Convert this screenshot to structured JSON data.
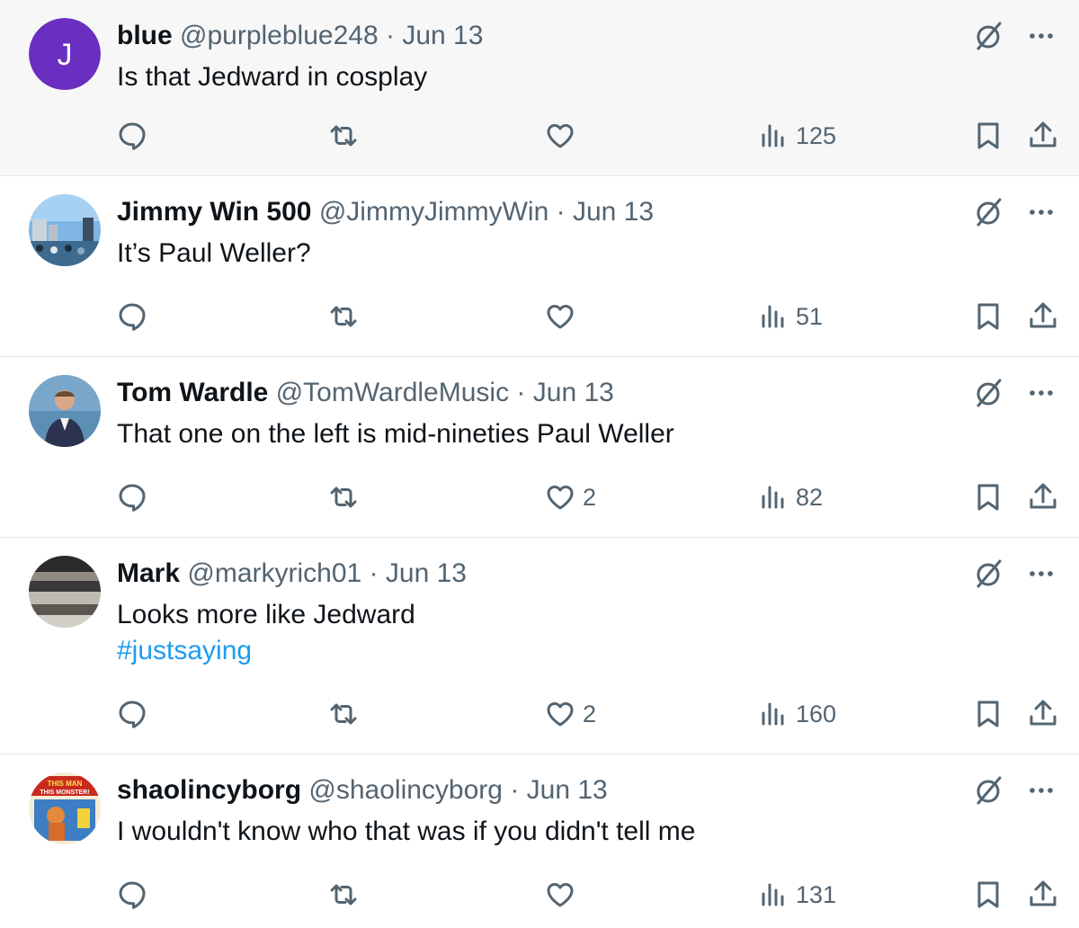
{
  "colors": {
    "text_primary": "#0f1419",
    "text_secondary": "#536471",
    "link": "#1d9bf0",
    "highlight_bg": "#f7f7f7",
    "divider": "#e6e9eb"
  },
  "icons": {
    "reply": "reply-icon",
    "retweet": "retweet-icon",
    "like": "heart-icon",
    "views": "views-icon",
    "bookmark": "bookmark-icon",
    "share": "share-icon",
    "grok": "grok-icon",
    "more": "more-icon"
  },
  "tweets": [
    {
      "avatar_letter": "J",
      "avatar_color": "#6a2fc0",
      "name": "blue",
      "handle": "@purpleblue248",
      "separator": "·",
      "date": "Jun 13",
      "text": "Is that Jedward in cosplay",
      "hashtag": "",
      "likes": "",
      "views": "125"
    },
    {
      "avatar_letter": "",
      "name": "Jimmy Win 500",
      "handle": "@JimmyJimmyWin",
      "separator": "·",
      "date": "Jun 13",
      "text": "It’s Paul Weller?",
      "hashtag": "",
      "likes": "",
      "views": "51"
    },
    {
      "avatar_letter": "",
      "name": "Tom Wardle",
      "handle": "@TomWardleMusic",
      "separator": "·",
      "date": "Jun 13",
      "text": "That one on the left is mid-nineties Paul Weller",
      "hashtag": "",
      "likes": "2",
      "views": "82"
    },
    {
      "avatar_letter": "",
      "name": "Mark",
      "handle": "@markyrich01",
      "separator": "·",
      "date": "Jun 13",
      "text": "Looks more like Jedward",
      "hashtag": "#justsaying",
      "likes": "2",
      "views": "160"
    },
    {
      "avatar_letter": "",
      "avatar_text": "THIS MAN THIS MONSTER!",
      "name": "shaolincyborg",
      "handle": "@shaolincyborg",
      "separator": "·",
      "date": "Jun 13",
      "text": "I wouldn't know who that was if you didn't tell me",
      "hashtag": "",
      "likes": "",
      "views": "131"
    }
  ]
}
